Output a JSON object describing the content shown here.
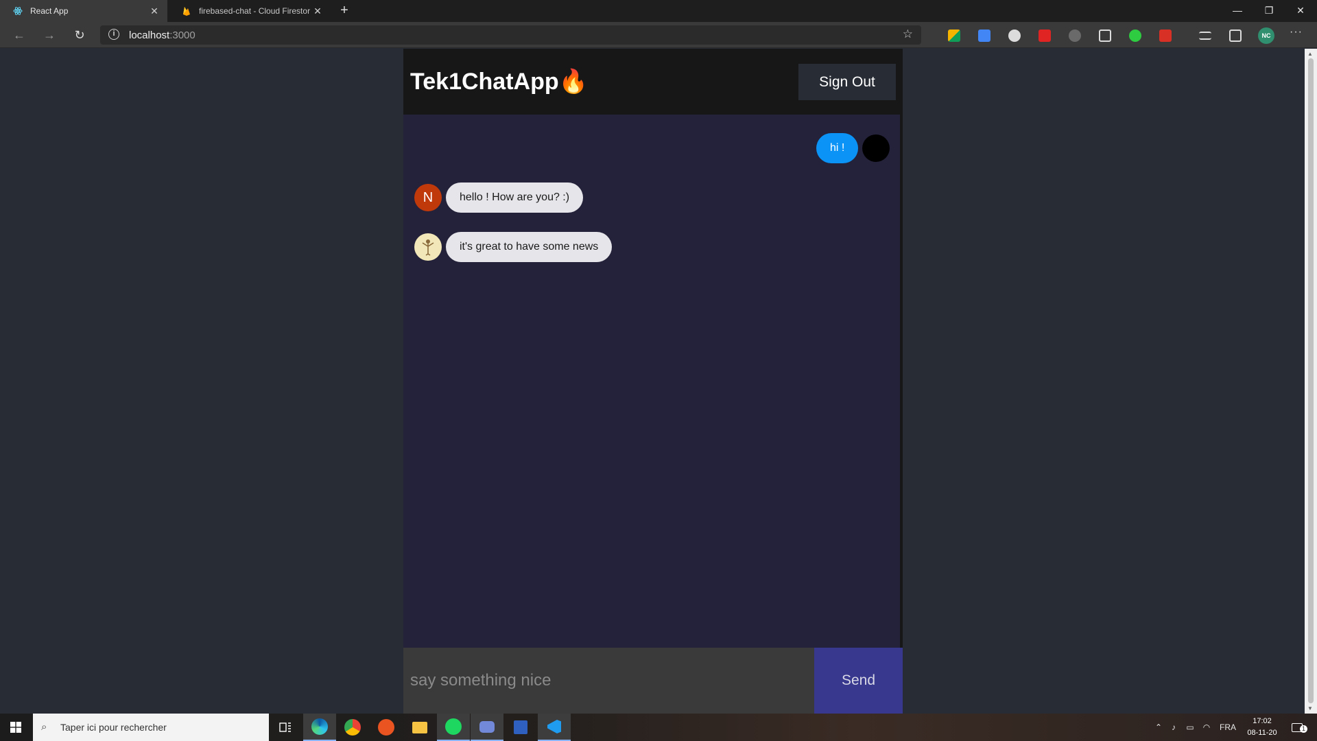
{
  "browser": {
    "tabs": [
      {
        "title": "React App",
        "active": true
      },
      {
        "title": "firebased-chat - Cloud Firestore",
        "active": false
      }
    ],
    "new_tab_label": "+",
    "url_host": "localhost",
    "url_port": ":3000",
    "profile_initials": "NC",
    "more_label": "···"
  },
  "app": {
    "title": "Tek1ChatApp",
    "title_emoji": "🔥",
    "signout_label": "Sign Out",
    "messages": [
      {
        "text": "hi !",
        "direction": "sent",
        "avatar": "black-circle"
      },
      {
        "text": "hello ! How are you? :)",
        "direction": "received",
        "avatar_letter": "N",
        "avatar_color": "#c0390b"
      },
      {
        "text": "it's great to have some news",
        "direction": "received",
        "avatar": "illustration"
      }
    ],
    "input_placeholder": "say something nice",
    "send_label": "Send"
  },
  "taskbar": {
    "search_placeholder": "Taper ici pour rechercher",
    "language": "FRA",
    "time": "17:02",
    "date": "08-11-20",
    "notification_count": "1"
  },
  "colors": {
    "page_bg": "#282c34",
    "header_bg": "#181717",
    "chat_bg": "#24223a",
    "sent_bubble": "#0b93f6",
    "received_bubble": "#e5e5ea",
    "send_button": "#38388f"
  }
}
